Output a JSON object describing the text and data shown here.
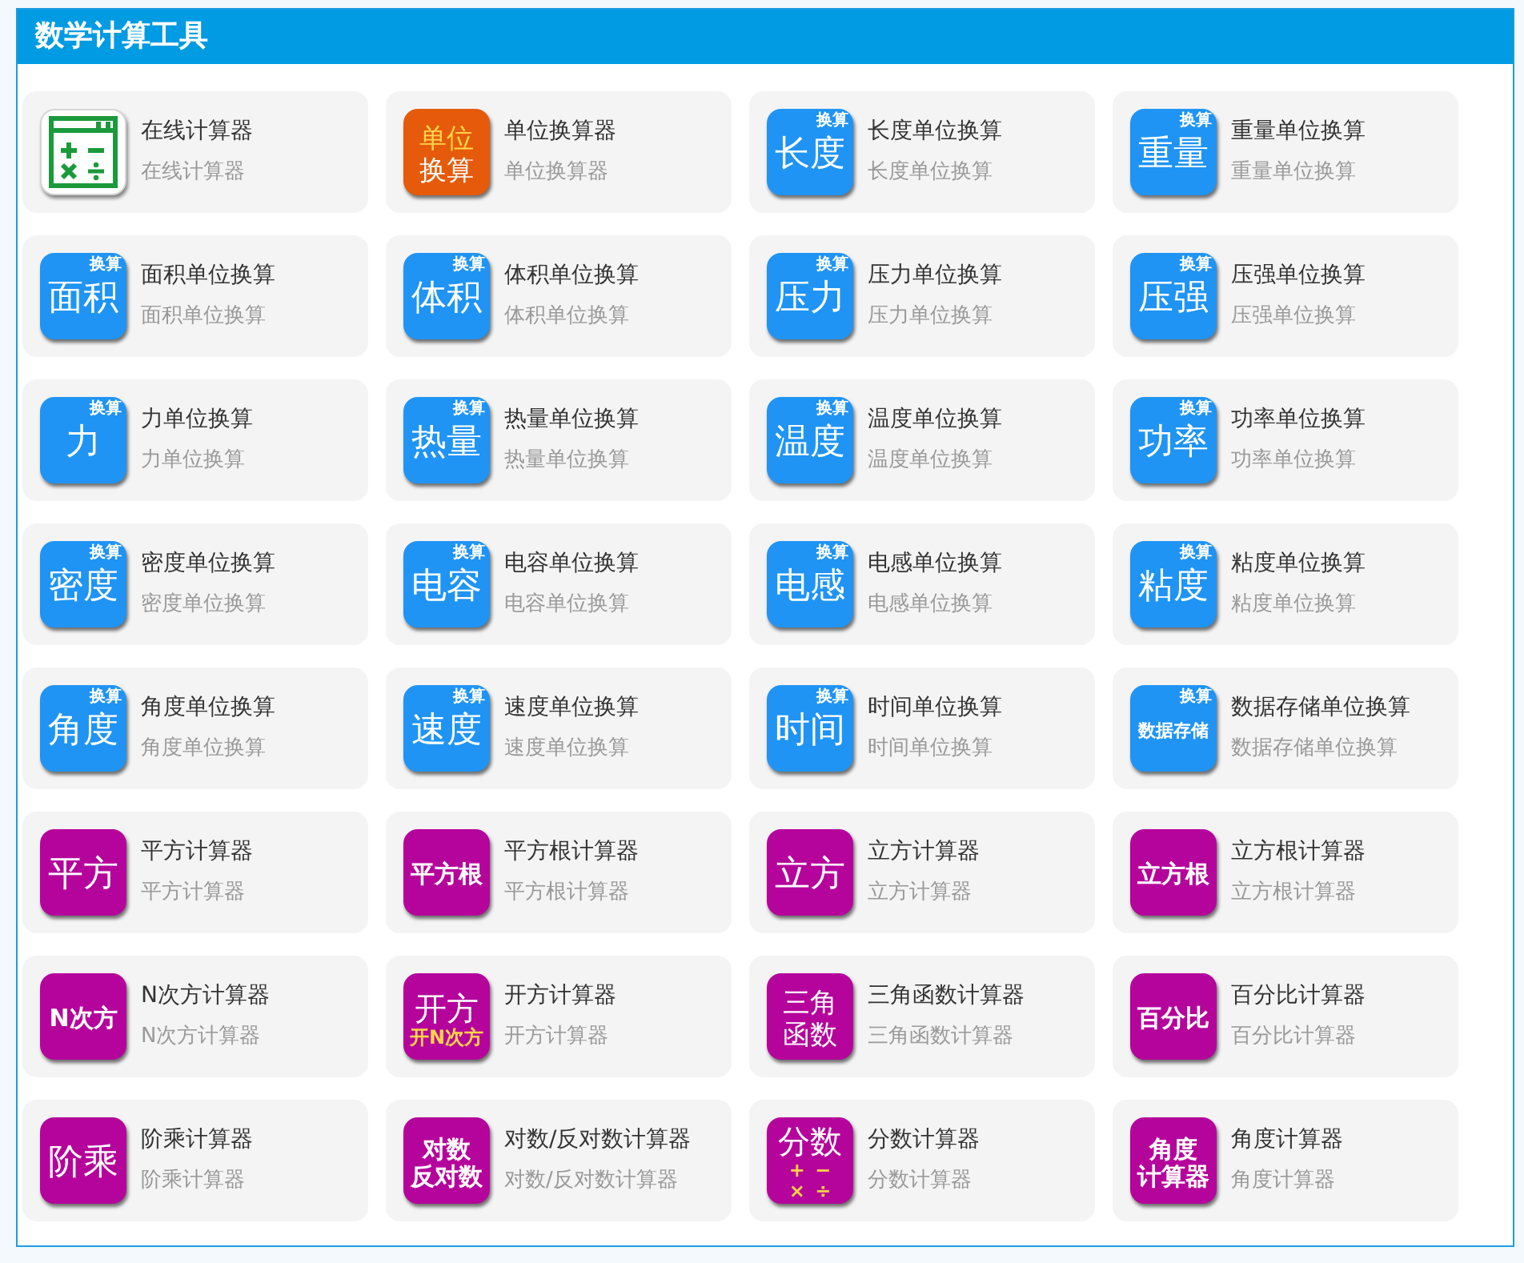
{
  "header": {
    "title": "数学计算工具"
  },
  "tools": [
    {
      "title": "在线计算器",
      "subtitle": "在线计算器",
      "icon": {
        "kind": "calculator"
      }
    },
    {
      "title": "单位换算器",
      "subtitle": "单位换算器",
      "icon": {
        "kind": "tile",
        "color": "#e65b0b",
        "lines": [
          {
            "text": "单位",
            "accent": true
          },
          {
            "text": "换算",
            "accent": false
          }
        ]
      }
    },
    {
      "title": "长度单位换算",
      "subtitle": "长度单位换算",
      "icon": {
        "kind": "tile",
        "color": "#1f94f5",
        "tag": "换算",
        "lines": [
          {
            "text": "长度",
            "accent": false
          }
        ]
      }
    },
    {
      "title": "重量单位换算",
      "subtitle": "重量单位换算",
      "icon": {
        "kind": "tile",
        "color": "#1f94f5",
        "tag": "换算",
        "lines": [
          {
            "text": "重量",
            "accent": false
          }
        ]
      }
    },
    {
      "title": "面积单位换算",
      "subtitle": "面积单位换算",
      "icon": {
        "kind": "tile",
        "color": "#1f94f5",
        "tag": "换算",
        "lines": [
          {
            "text": "面积",
            "accent": false
          }
        ]
      }
    },
    {
      "title": "体积单位换算",
      "subtitle": "体积单位换算",
      "icon": {
        "kind": "tile",
        "color": "#1f94f5",
        "tag": "换算",
        "lines": [
          {
            "text": "体积",
            "accent": false
          }
        ]
      }
    },
    {
      "title": "压力单位换算",
      "subtitle": "压力单位换算",
      "icon": {
        "kind": "tile",
        "color": "#1f94f5",
        "tag": "换算",
        "lines": [
          {
            "text": "压力",
            "accent": false
          }
        ]
      }
    },
    {
      "title": "压强单位换算",
      "subtitle": "压强单位换算",
      "icon": {
        "kind": "tile",
        "color": "#1f94f5",
        "tag": "换算",
        "lines": [
          {
            "text": "压强",
            "accent": false
          }
        ]
      }
    },
    {
      "title": "力单位换算",
      "subtitle": "力单位换算",
      "icon": {
        "kind": "tile",
        "color": "#1f94f5",
        "tag": "换算",
        "lines": [
          {
            "text": "力",
            "accent": false
          }
        ]
      }
    },
    {
      "title": "热量单位换算",
      "subtitle": "热量单位换算",
      "icon": {
        "kind": "tile",
        "color": "#1f94f5",
        "tag": "换算",
        "lines": [
          {
            "text": "热量",
            "accent": false
          }
        ]
      }
    },
    {
      "title": "温度单位换算",
      "subtitle": "温度单位换算",
      "icon": {
        "kind": "tile",
        "color": "#1f94f5",
        "tag": "换算",
        "lines": [
          {
            "text": "温度",
            "accent": false
          }
        ]
      }
    },
    {
      "title": "功率单位换算",
      "subtitle": "功率单位换算",
      "icon": {
        "kind": "tile",
        "color": "#1f94f5",
        "tag": "换算",
        "lines": [
          {
            "text": "功率",
            "accent": false
          }
        ]
      }
    },
    {
      "title": "密度单位换算",
      "subtitle": "密度单位换算",
      "icon": {
        "kind": "tile",
        "color": "#1f94f5",
        "tag": "换算",
        "lines": [
          {
            "text": "密度",
            "accent": false
          }
        ]
      }
    },
    {
      "title": "电容单位换算",
      "subtitle": "电容单位换算",
      "icon": {
        "kind": "tile",
        "color": "#1f94f5",
        "tag": "换算",
        "lines": [
          {
            "text": "电容",
            "accent": false
          }
        ]
      }
    },
    {
      "title": "电感单位换算",
      "subtitle": "电感单位换算",
      "icon": {
        "kind": "tile",
        "color": "#1f94f5",
        "tag": "换算",
        "lines": [
          {
            "text": "电感",
            "accent": false
          }
        ]
      }
    },
    {
      "title": "粘度单位换算",
      "subtitle": "粘度单位换算",
      "icon": {
        "kind": "tile",
        "color": "#1f94f5",
        "tag": "换算",
        "lines": [
          {
            "text": "粘度",
            "accent": false
          }
        ]
      }
    },
    {
      "title": "角度单位换算",
      "subtitle": "角度单位换算",
      "icon": {
        "kind": "tile",
        "color": "#1f94f5",
        "tag": "换算",
        "lines": [
          {
            "text": "角度",
            "accent": false
          }
        ]
      }
    },
    {
      "title": "速度单位换算",
      "subtitle": "速度单位换算",
      "icon": {
        "kind": "tile",
        "color": "#1f94f5",
        "tag": "换算",
        "lines": [
          {
            "text": "速度",
            "accent": false
          }
        ]
      }
    },
    {
      "title": "时间单位换算",
      "subtitle": "时间单位换算",
      "icon": {
        "kind": "tile",
        "color": "#1f94f5",
        "tag": "换算",
        "lines": [
          {
            "text": "时间",
            "accent": false
          }
        ]
      }
    },
    {
      "title": "数据存储单位换算",
      "subtitle": "数据存储单位换算",
      "icon": {
        "kind": "tile",
        "color": "#1f94f5",
        "tag": "换算",
        "lines": [
          {
            "text": "数据存储",
            "accent": false
          }
        ]
      }
    },
    {
      "title": "平方计算器",
      "subtitle": "平方计算器",
      "icon": {
        "kind": "tile",
        "color": "#b5049b",
        "lines": [
          {
            "text": "平方",
            "accent": false
          }
        ]
      }
    },
    {
      "title": "平方根计算器",
      "subtitle": "平方根计算器",
      "icon": {
        "kind": "tile",
        "color": "#b5049b",
        "lines": [
          {
            "text": "平方根",
            "accent": false
          }
        ]
      }
    },
    {
      "title": "立方计算器",
      "subtitle": "立方计算器",
      "icon": {
        "kind": "tile",
        "color": "#b5049b",
        "lines": [
          {
            "text": "立方",
            "accent": false
          }
        ]
      }
    },
    {
      "title": "立方根计算器",
      "subtitle": "立方根计算器",
      "icon": {
        "kind": "tile",
        "color": "#b5049b",
        "lines": [
          {
            "text": "立方根",
            "accent": false
          }
        ]
      }
    },
    {
      "title": "N次方计算器",
      "subtitle": "N次方计算器",
      "icon": {
        "kind": "tile",
        "color": "#b5049b",
        "lines": [
          {
            "text": "N次方",
            "accent": false
          }
        ]
      }
    },
    {
      "title": "开方计算器",
      "subtitle": "开方计算器",
      "icon": {
        "kind": "tile",
        "color": "#b5049b",
        "lines": [
          {
            "text": "开方",
            "accent": false
          },
          {
            "text": "开N次方",
            "accent": true
          }
        ]
      }
    },
    {
      "title": "三角函数计算器",
      "subtitle": "三角函数计算器",
      "icon": {
        "kind": "tile",
        "color": "#b5049b",
        "lines": [
          {
            "text": "三角",
            "accent": false
          },
          {
            "text": "函数",
            "accent": false
          }
        ]
      }
    },
    {
      "title": "百分比计算器",
      "subtitle": "百分比计算器",
      "icon": {
        "kind": "tile",
        "color": "#b5049b",
        "lines": [
          {
            "text": "百分比",
            "accent": false
          }
        ]
      }
    },
    {
      "title": "阶乘计算器",
      "subtitle": "阶乘计算器",
      "icon": {
        "kind": "tile",
        "color": "#b5049b",
        "lines": [
          {
            "text": "阶乘",
            "accent": false
          }
        ]
      }
    },
    {
      "title": "对数/反对数计算器",
      "subtitle": "对数/反对数计算器",
      "icon": {
        "kind": "tile",
        "color": "#b5049b",
        "lines": [
          {
            "text": "对数",
            "accent": false
          },
          {
            "text": "反对数",
            "accent": false
          }
        ]
      }
    },
    {
      "title": "分数计算器",
      "subtitle": "分数计算器",
      "icon": {
        "kind": "tile",
        "color": "#b5049b",
        "lines": [
          {
            "text": "分数",
            "accent": false
          },
          {
            "text": "+ −",
            "accent": true
          },
          {
            "text": "× ÷",
            "accent": true
          }
        ]
      }
    },
    {
      "title": "角度计算器",
      "subtitle": "角度计算器",
      "icon": {
        "kind": "tile",
        "color": "#b5049b",
        "lines": [
          {
            "text": "角度",
            "accent": false
          },
          {
            "text": "计算器",
            "accent": false
          }
        ]
      }
    }
  ]
}
